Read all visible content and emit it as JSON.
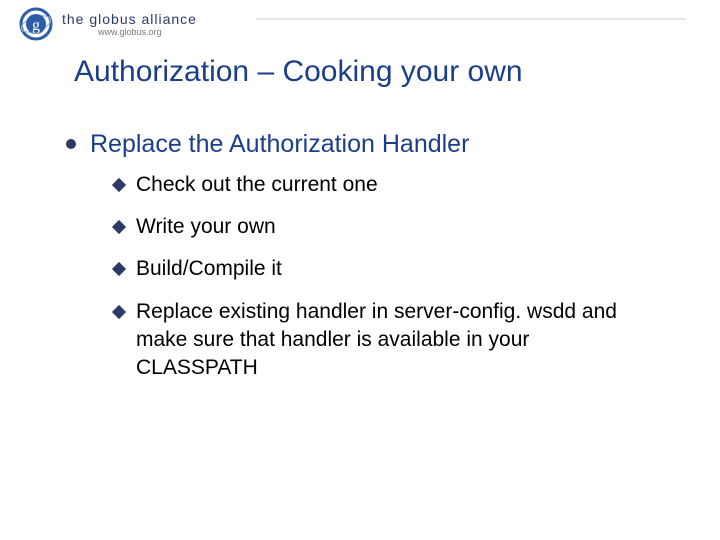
{
  "logo": {
    "text_main": "the globus alliance",
    "text_sub": "www.globus.org",
    "mark_letter": "g",
    "colors": {
      "ring": "#2b5dab",
      "letter": "#ffffff"
    }
  },
  "title": "Authorization – Cooking your own",
  "outer": {
    "text": "Replace the Authorization Handler"
  },
  "inner": [
    "Check out the current one",
    "Write your own",
    "Build/Compile it",
    "Replace existing handler in server-config. wsdd and make sure that handler is available in your CLASSPATH"
  ]
}
